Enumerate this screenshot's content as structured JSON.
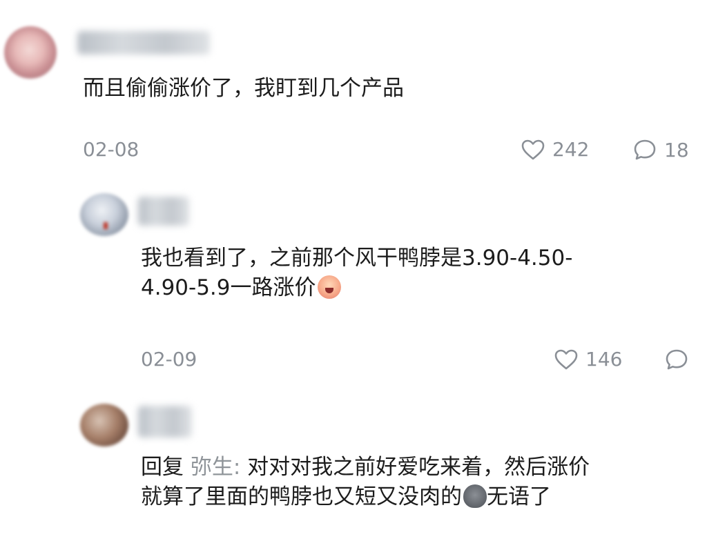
{
  "comments": [
    {
      "text": "而且偷偷涨价了，我盯到几个产品",
      "date": "02-08",
      "likes": "242",
      "replies": "18"
    },
    {
      "text_line1": "我也看到了，之前那个风干鸭脖是3.90-4.50-",
      "text_line2": "4.90-5.9一路涨价",
      "emoji": "crying-face-emoji",
      "date": "02-09",
      "likes": "146",
      "replies": ""
    },
    {
      "reply_prefix": "回复 ",
      "reply_to": "弥生:",
      "text_line1": " 对对对我之前好爱吃来着，然后涨价",
      "text_line2": "就算了里面的鸭脖也又短又没肉的",
      "text_line2_end": "无语了",
      "emoji": "speechless-face-emoji"
    }
  ],
  "icons": {
    "like": "heart-outline-icon",
    "reply": "speech-bubble-outline-icon"
  },
  "colors": {
    "text": "#1c1c1c",
    "meta": "#8a8f96",
    "reply_to": "#8f9499"
  }
}
